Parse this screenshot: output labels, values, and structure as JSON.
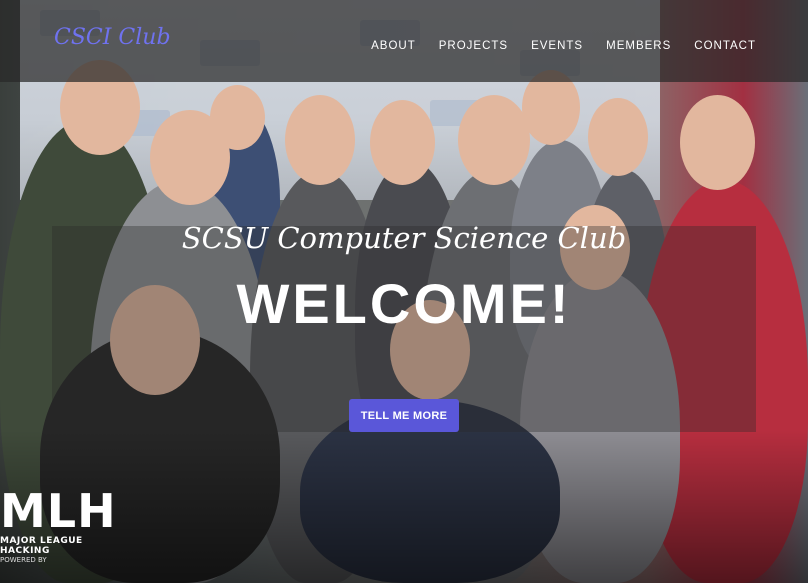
{
  "brand": {
    "name": "CSCI Club"
  },
  "nav": {
    "items": [
      {
        "label": "ABOUT"
      },
      {
        "label": "PROJECTS"
      },
      {
        "label": "EVENTS"
      },
      {
        "label": "MEMBERS"
      },
      {
        "label": "CONTACT"
      }
    ]
  },
  "hero": {
    "subtitle": "SCSU Computer Science Club",
    "headline": "WELCOME!",
    "cta_label": "TELL ME MORE",
    "photo_badge": {
      "logo_text": "MLH",
      "tagline": "MAJOR LEAGUE HACKING",
      "powered_by": "POWERED BY"
    }
  },
  "colors": {
    "brand": "#6f72ef",
    "cta": "#5a57d9",
    "navbar": "rgba(40,40,40,.72)"
  }
}
